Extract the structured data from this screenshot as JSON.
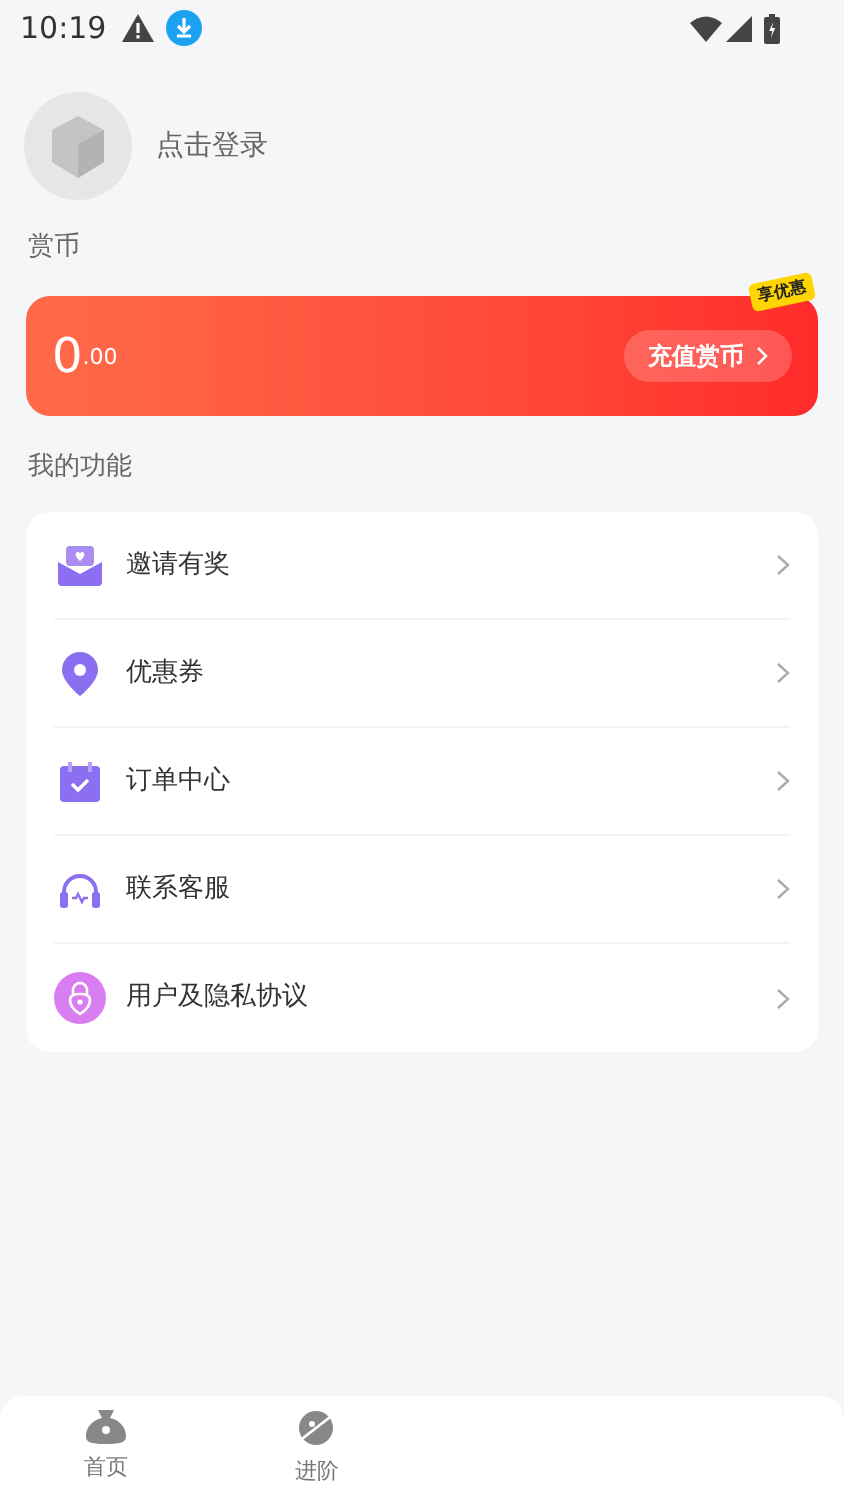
{
  "status_bar": {
    "time": "10:19"
  },
  "profile": {
    "login_label": "点击登录"
  },
  "coins": {
    "section_title": "赏币",
    "amount_main": "0",
    "amount_decimal": ".00",
    "recharge_label": "充值赏币",
    "badge": "享优惠"
  },
  "functions": {
    "section_title": "我的功能",
    "items": [
      {
        "kind": "envelope",
        "label": "邀请有奖"
      },
      {
        "kind": "pin",
        "label": "优惠券"
      },
      {
        "kind": "calendar",
        "label": "订单中心"
      },
      {
        "kind": "headset",
        "label": "联系客服"
      },
      {
        "kind": "lock",
        "label": "用户及隐私协议"
      }
    ]
  },
  "bottom_nav": [
    {
      "kind": "bag",
      "label": "首页"
    },
    {
      "kind": "planet",
      "label": "进阶"
    }
  ]
}
